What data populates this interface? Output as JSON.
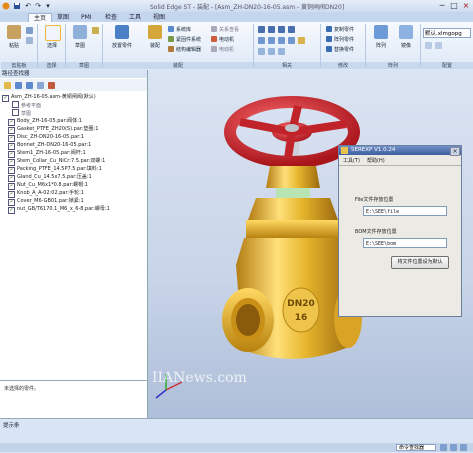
{
  "window": {
    "title": "Solid Edge ST - 装配 - [Asm_ZH-DN20-16-05.asm - 黄铜闸阀DN20]",
    "min": "─",
    "max": "□",
    "close": "×",
    "quick_access_icons": [
      "save-icon",
      "undo-icon",
      "redo-icon",
      "dropdown-icon"
    ]
  },
  "tabs": [
    "主页",
    "草图",
    "PMI",
    "检查",
    "工具",
    "视图"
  ],
  "ribbon": {
    "groups": {
      "clipboard": {
        "label": "剪贴板",
        "paste": "粘贴"
      },
      "select": {
        "label": "选择",
        "select": "选择",
        "sketch": "草图"
      },
      "sketch": {
        "label": "草图"
      },
      "assemble": {
        "label": "装配",
        "place_part": "放置零件",
        "assemble": "装配",
        "items": [
          "系统库",
          "紧固件系统",
          "结构编辑器",
          "关系查看",
          "电动机",
          "电动机",
          "装配线"
        ]
      },
      "relate": {
        "label": "相关"
      },
      "modify": {
        "label": "修改",
        "items": [
          "复制零件",
          "阵列零件",
          "替换零件"
        ]
      },
      "pattern": {
        "label": "阵列",
        "array": "阵列",
        "mirror": "镜像"
      },
      "config": {
        "label": "配置",
        "value": "默认.xlmgopg"
      }
    }
  },
  "pathfinder": {
    "title": "路径查找器",
    "root": "Asm_ZH-16-05.asm-黄铜闸阀(默认)",
    "ref_plane": "参考平面",
    "sketch": "草图",
    "items": [
      "Body_ZH-16-05.par:阀体:1",
      "Gasket_PTFE_ZH20(S).par:垫圈:1",
      "Disc_ZH-DN20-16-05.par:1",
      "Bonnet_ZH-DN20-16-05.par:1",
      "Stem1_ZH-16-05.par:阀杆:1",
      "Stem_Collar_Cu_NiCr:7.5.par:双螺:1",
      "Packing_PTFE_14.5P7.5.par:填料:1",
      "Gland_Cu_14.5x7.5.par:压盖:1",
      "Nut_Cu_M6x1*0.8.par:螺帽:1",
      "Knob_A_A-02:02.par:手轮:1",
      "Cover_M6-GB01.par:锁紧:1",
      "nut_GB/T6170.1_M6_x_6-8.par:螺母:1"
    ],
    "note": "未选择的零件。"
  },
  "dialog": {
    "title": "SEREXP V1.0.24",
    "menu": [
      "工具(T)",
      "帮助(H)"
    ],
    "file_label": "File文件存放位置",
    "file_value": "E:\\SEE\\file",
    "bom_label": "BOM文件存放位置",
    "bom_value": "E:\\SEE\\bom",
    "button": "将文件位置设为默认"
  },
  "viewport": {
    "watermark": "IIANews.com",
    "valve_text": [
      "DN20",
      "16"
    ]
  },
  "status": {
    "prompt": "提示条",
    "command_finder": "命令查找器"
  },
  "colors": {
    "brass": "#e6b52c",
    "handwheel": "#d42b2f",
    "ribbon_bg": "#e4ecf7",
    "dialog_title": "#4a6aac"
  }
}
